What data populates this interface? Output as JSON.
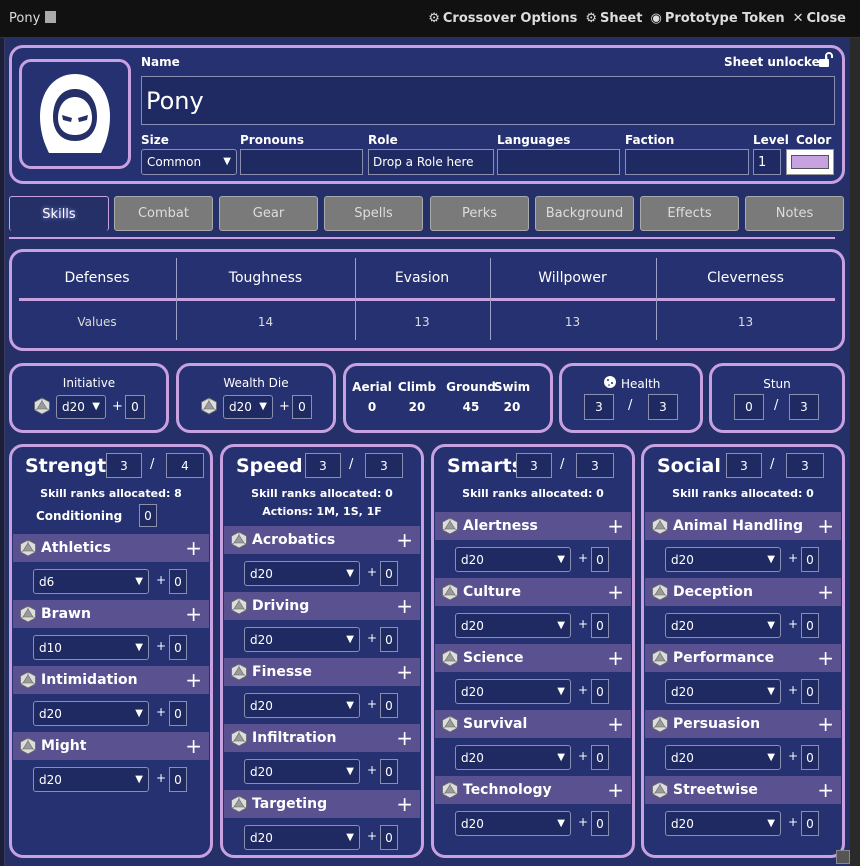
{
  "window": {
    "title": "Pony",
    "actions": [
      "Crossover Options",
      "Sheet",
      "Prototype Token",
      "Close"
    ]
  },
  "header": {
    "name_label": "Name",
    "name": "Pony",
    "lock_label": "Sheet unlocked",
    "size_label": "Size",
    "size_value": "Common",
    "pronouns_label": "Pronouns",
    "pronouns_value": "",
    "role_label": "Role",
    "role_value": "Drop a Role here",
    "languages_label": "Languages",
    "languages_value": "",
    "faction_label": "Faction",
    "faction_value": "",
    "level_label": "Level",
    "level_value": "1",
    "color_label": "Color",
    "color_value": "#c7a1e0"
  },
  "tabs": [
    "Skills",
    "Combat",
    "Gear",
    "Spells",
    "Perks",
    "Background",
    "Effects",
    "Notes"
  ],
  "defenses": {
    "headers": [
      "Defenses",
      "Toughness",
      "Evasion",
      "Willpower",
      "Cleverness"
    ],
    "values": [
      "Values",
      "14",
      "13",
      "13",
      "13"
    ]
  },
  "initiative": {
    "label": "Initiative",
    "die": "d20",
    "bonus": "0"
  },
  "wealth": {
    "label": "Wealth Die",
    "die": "d20",
    "bonus": "0"
  },
  "movement": {
    "labels": [
      "Aerial",
      "Climb",
      "Ground",
      "Swim"
    ],
    "values": [
      "0",
      "20",
      "45",
      "20"
    ]
  },
  "health": {
    "label": "Health",
    "current": "3",
    "max": "3"
  },
  "stun": {
    "label": "Stun",
    "current": "0",
    "max": "3"
  },
  "plus_sign": "+",
  "slash_sign": "/",
  "attributes": [
    {
      "name": "Strength",
      "value": "3",
      "max": "4",
      "ranks": "Skill ranks allocated: 8",
      "extra_label": "Conditioning",
      "extra_value": "0",
      "skills": [
        {
          "name": "Athletics",
          "die": "d6",
          "bonus": "0"
        },
        {
          "name": "Brawn",
          "die": "d10",
          "bonus": "0"
        },
        {
          "name": "Intimidation",
          "die": "d20",
          "bonus": "0"
        },
        {
          "name": "Might",
          "die": "d20",
          "bonus": "0"
        }
      ]
    },
    {
      "name": "Speed",
      "value": "3",
      "max": "3",
      "ranks": "Skill ranks allocated: 0",
      "actions": "Actions: 1M, 1S, 1F",
      "skills": [
        {
          "name": "Acrobatics",
          "die": "d20",
          "bonus": "0"
        },
        {
          "name": "Driving",
          "die": "d20",
          "bonus": "0"
        },
        {
          "name": "Finesse",
          "die": "d20",
          "bonus": "0"
        },
        {
          "name": "Infiltration",
          "die": "d20",
          "bonus": "0"
        },
        {
          "name": "Targeting",
          "die": "d20",
          "bonus": "0"
        }
      ]
    },
    {
      "name": "Smarts",
      "value": "3",
      "max": "3",
      "ranks": "Skill ranks allocated: 0",
      "skills": [
        {
          "name": "Alertness",
          "die": "d20",
          "bonus": "0"
        },
        {
          "name": "Culture",
          "die": "d20",
          "bonus": "0"
        },
        {
          "name": "Science",
          "die": "d20",
          "bonus": "0"
        },
        {
          "name": "Survival",
          "die": "d20",
          "bonus": "0"
        },
        {
          "name": "Technology",
          "die": "d20",
          "bonus": "0"
        }
      ]
    },
    {
      "name": "Social",
      "value": "3",
      "max": "3",
      "ranks": "Skill ranks allocated: 0",
      "skills": [
        {
          "name": "Animal Handling",
          "die": "d20",
          "bonus": "0"
        },
        {
          "name": "Deception",
          "die": "d20",
          "bonus": "0"
        },
        {
          "name": "Performance",
          "die": "d20",
          "bonus": "0"
        },
        {
          "name": "Persuasion",
          "die": "d20",
          "bonus": "0"
        },
        {
          "name": "Streetwise",
          "die": "d20",
          "bonus": "0"
        }
      ]
    }
  ]
}
